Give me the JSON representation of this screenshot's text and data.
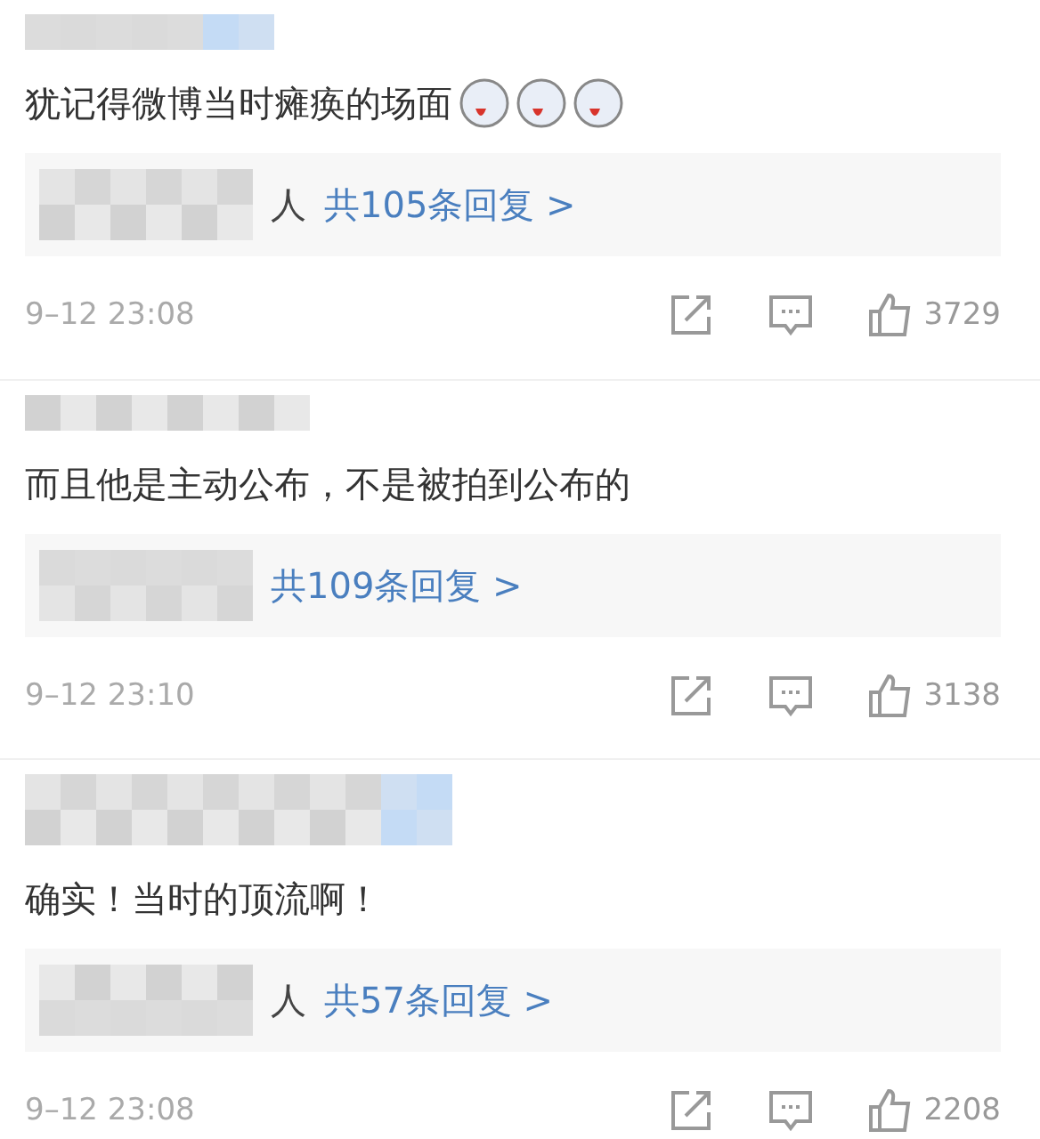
{
  "comments": [
    {
      "text": "犹记得微博当时瘫痪的场面",
      "emojis": [
        {
          "kind": "tongue"
        },
        {
          "kind": "tongue"
        },
        {
          "kind": "tongue"
        }
      ],
      "replies": {
        "suffix": "人",
        "link": "共105条回复 >"
      },
      "time": "9–12 23:08",
      "likes": "3729"
    },
    {
      "text": "而且他是主动公布，不是被拍到公布的",
      "replies": {
        "link": "共109条回复 >"
      },
      "time": "9–12 23:10",
      "likes": "3138"
    },
    {
      "text": "确实！当时的顶流啊！",
      "replies": {
        "suffix": "人",
        "link": "共57条回复 >"
      },
      "time": "9–12 23:08",
      "likes": "2208"
    }
  ]
}
